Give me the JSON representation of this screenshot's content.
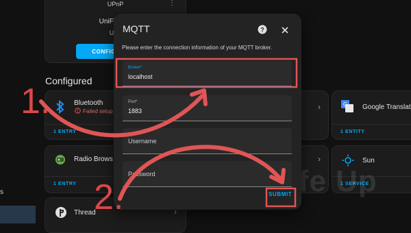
{
  "sidebar": {
    "item_text": "s"
  },
  "discovered_card": {
    "badge": "UPnP",
    "name": "UniFi Drea",
    "sub": "UPn",
    "configure_label": "CONFIGURE"
  },
  "section_title": "Configured",
  "entries": {
    "bluetooth": {
      "name": "Bluetooth",
      "status": "Failed setup",
      "count": "1 ENTRY"
    },
    "radio": {
      "name": "Radio Brows",
      "count": "1 ENTRY"
    },
    "thread": {
      "name": "Thread"
    },
    "google": {
      "name": "Google Translate",
      "count": "1 ENTITY"
    },
    "sun": {
      "name": "Sun",
      "count": "1 SERVICE"
    }
  },
  "dialog": {
    "title": "MQTT",
    "description": "Please enter the connection information of your MQTT broker.",
    "fields": {
      "broker": {
        "label": "Broker*",
        "value": "localhost"
      },
      "port": {
        "label": "Port*",
        "value": "1883"
      },
      "username": {
        "placeholder": "Username"
      },
      "password": {
        "placeholder": "Password"
      }
    },
    "submit_label": "SUBMIT"
  },
  "annotations": {
    "step1": "1.",
    "step2": "2."
  },
  "watermark": "PiMyLife Up",
  "colors": {
    "accent": "#03a9f4",
    "annotation": "#e05555",
    "dialog_bg": "#232323",
    "page_bg": "#111111"
  },
  "icons": [
    "bluetooth-icon",
    "radio-browser-icon",
    "thread-icon",
    "google-translate-icon",
    "sun-icon",
    "help-icon",
    "close-icon",
    "warning-icon",
    "chevron-right-icon",
    "overflow-menu-icon"
  ]
}
